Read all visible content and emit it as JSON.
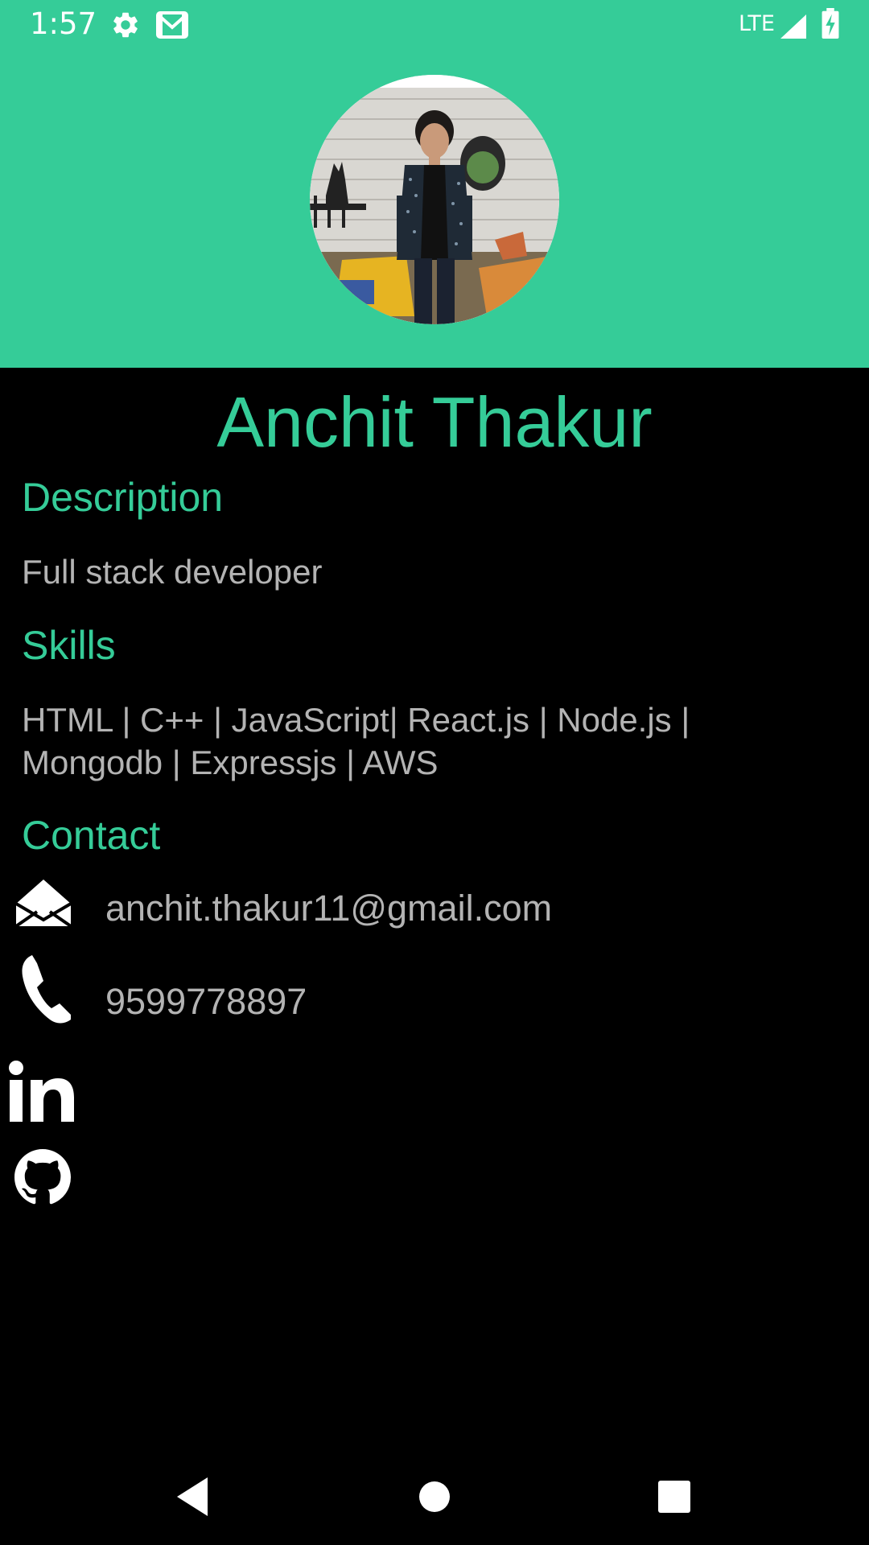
{
  "status_bar": {
    "time": "1:57",
    "network": "LTE",
    "icons": [
      "settings-icon",
      "gmail-icon",
      "signal-icon",
      "battery-charging-icon"
    ]
  },
  "profile": {
    "avatar_icon": "profile-photo",
    "name": "Anchit Thakur"
  },
  "sections": {
    "description": {
      "title": "Description",
      "text": "Full stack developer"
    },
    "skills": {
      "title": "Skills",
      "line1": "HTML | C++ | JavaScript| React.js | Node.js |",
      "line2": "Mongodb | Expressjs | AWS"
    },
    "contact": {
      "title": "Contact",
      "email": "anchit.thakur11@gmail.com",
      "phone": "9599778897",
      "email_icon": "envelope-open-icon",
      "phone_icon": "phone-icon"
    }
  },
  "social": {
    "linkedin_icon": "linkedin-icon",
    "github_icon": "github-icon"
  },
  "nav_bar": {
    "buttons": [
      "back-icon",
      "home-icon",
      "recents-icon"
    ]
  },
  "colors": {
    "accent": "#35cc98",
    "background": "#000000",
    "text_secondary": "#b3b3b3",
    "icon": "#ffffff"
  }
}
